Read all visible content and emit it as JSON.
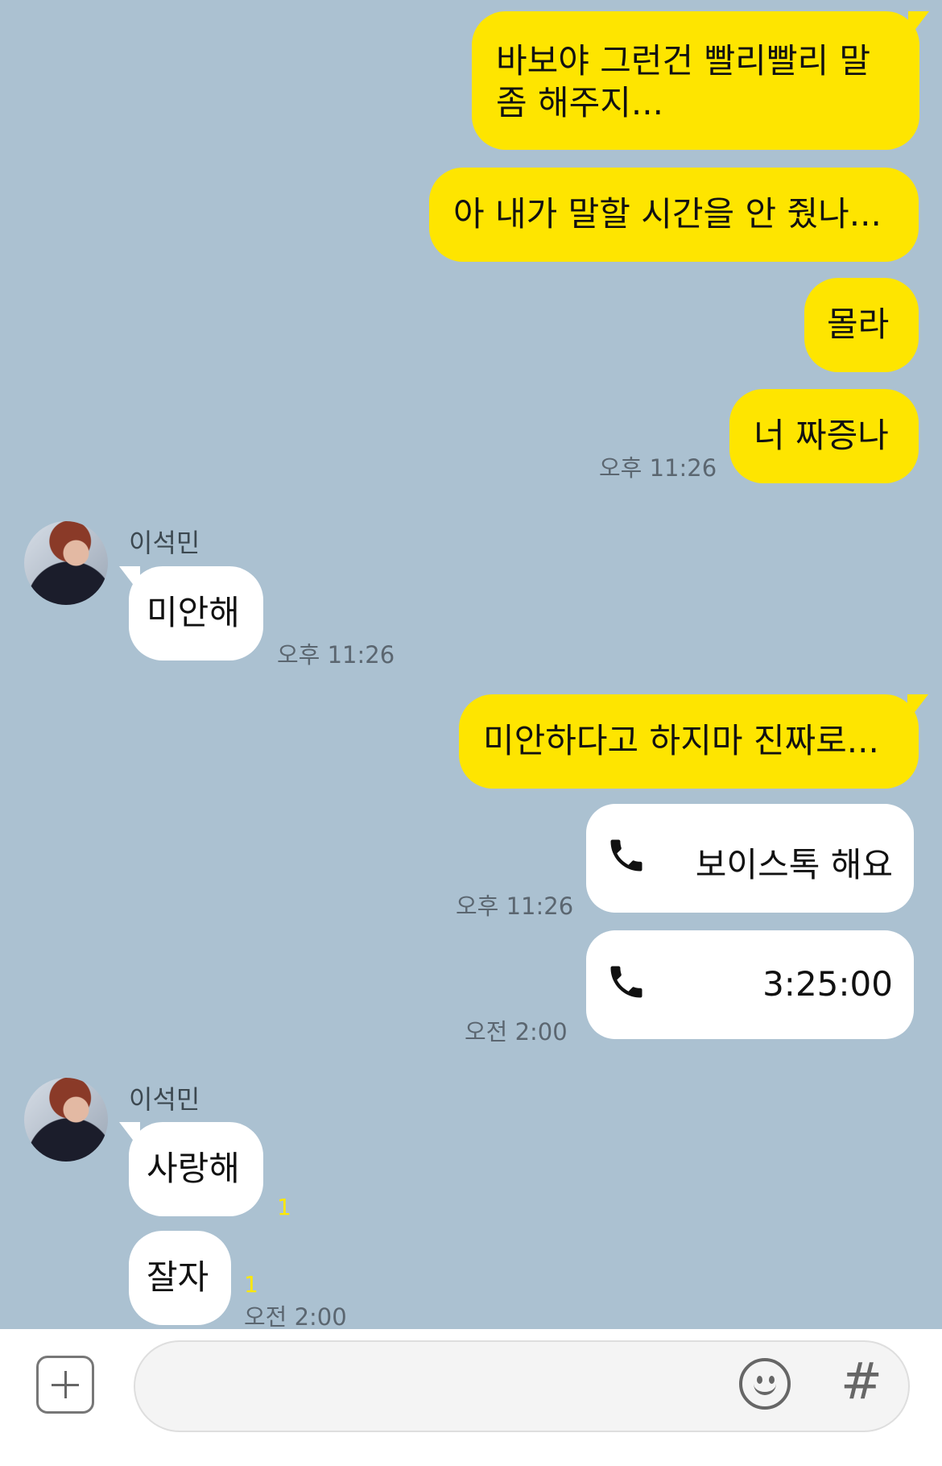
{
  "contact_name": "이석민",
  "messages": {
    "m1": "바보야 그런건 빨리빨리 말 좀 해주지...",
    "m2": "아 내가 말할 시간을 안 줬나...",
    "m3": "몰라",
    "m4": "너 짜증나",
    "m4_time": "오후 11:26",
    "f1": "미안해",
    "f1_time": "오후 11:26",
    "m5": "미안하다고 하지마 진짜로...",
    "voice1_label": "보이스톡 해요",
    "voice1_time": "오후 11:26",
    "voice2_label": "3:25:00",
    "voice2_time": "오전 2:00",
    "f2": "사랑해",
    "f2_unread": "1",
    "f3": "잘자",
    "f3_unread": "1",
    "f3_time": "오전 2:00"
  },
  "input_bar": {
    "plus_icon": "plus-square-icon",
    "emoji_icon": "emoji-icon",
    "hash_label": "#"
  },
  "colors": {
    "background": "#abc1d1",
    "my_bubble": "#fee500",
    "friend_bubble": "#ffffff",
    "unread": "#ffe800"
  }
}
